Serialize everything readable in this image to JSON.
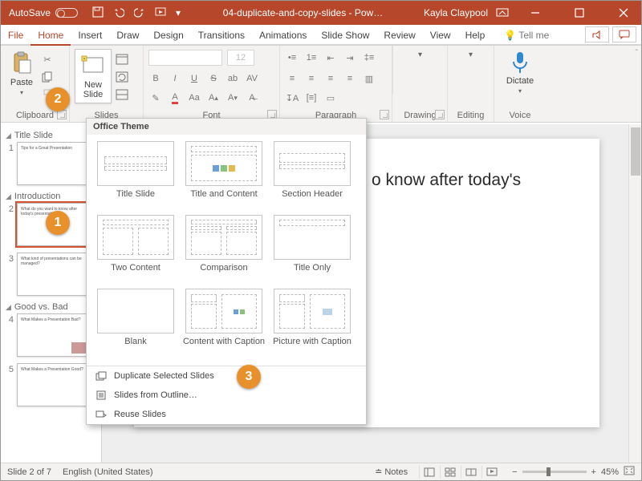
{
  "titlebar": {
    "autosave_label": "AutoSave",
    "autosave_state": "Off",
    "doc_title": "04-duplicate-and-copy-slides - Pow…",
    "user": "Kayla Claypool"
  },
  "tabs": {
    "file": "File",
    "home": "Home",
    "insert": "Insert",
    "draw": "Draw",
    "design": "Design",
    "transitions": "Transitions",
    "animations": "Animations",
    "slideshow": "Slide Show",
    "review": "Review",
    "view": "View",
    "help": "Help",
    "tellme": "Tell me"
  },
  "ribbon": {
    "clipboard_label": "Clipboard",
    "paste": "Paste",
    "slides_label": "Slides",
    "newslide": "New\nSlide",
    "font_label": "Font",
    "font_size": "12",
    "paragraph_label": "Paragraph",
    "drawing_label": "Drawing",
    "editing_label": "Editing",
    "voice_label": "Voice",
    "dictate": "Dictate"
  },
  "sections": {
    "s1": "Title Slide",
    "s2": "Introduction",
    "s3": "Good vs. Bad"
  },
  "thumbs": {
    "t1_title": "Tips for a Great Presentation",
    "t2_title": "What do you want to know after today's presentation?",
    "t3_title": "What kind of presentations can be managed?",
    "t4_title": "What Makes a Presentation Bad?",
    "t5_title": "What Makes a Presentation Good?"
  },
  "slide": {
    "body_visible": "o know after today's"
  },
  "gallery": {
    "header": "Office Theme",
    "layouts": {
      "l1": "Title Slide",
      "l2": "Title and Content",
      "l3": "Section Header",
      "l4": "Two Content",
      "l5": "Comparison",
      "l6": "Title Only",
      "l7": "Blank",
      "l8": "Content with Caption",
      "l9": "Picture with Caption"
    },
    "menu": {
      "duplicate": "Duplicate Selected Slides",
      "outline": "Slides from Outline…",
      "reuse": "Reuse Slides"
    }
  },
  "statusbar": {
    "slide": "Slide 2 of 7",
    "lang": "English (United States)",
    "notes": "Notes",
    "zoom": "45%"
  }
}
